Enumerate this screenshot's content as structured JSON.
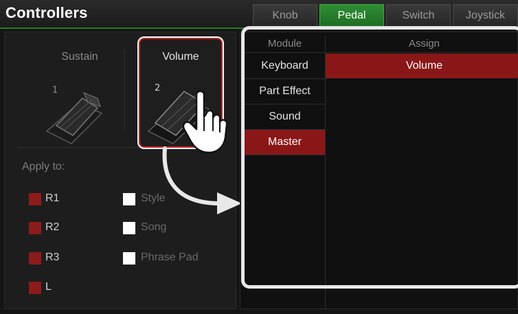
{
  "header": {
    "title": "Controllers",
    "tabs": [
      {
        "label": "Knob",
        "active": false
      },
      {
        "label": "Pedal",
        "active": true
      },
      {
        "label": "Switch",
        "active": false
      },
      {
        "label": "Joystick",
        "active": false
      }
    ]
  },
  "pedals": [
    {
      "label": "Sustain",
      "number": "1",
      "selected": false
    },
    {
      "label": "Volume",
      "number": "2",
      "selected": true
    }
  ],
  "apply_to": {
    "label": "Apply to:",
    "parts": [
      {
        "label": "R1",
        "checked": true
      },
      {
        "label": "R2",
        "checked": true
      },
      {
        "label": "R3",
        "checked": true
      },
      {
        "label": "L",
        "checked": true
      }
    ],
    "extras": [
      {
        "label": "Style",
        "enabled": false
      },
      {
        "label": "Song",
        "enabled": false
      },
      {
        "label": "Phrase Pad",
        "enabled": false
      }
    ]
  },
  "module_column": {
    "header": "Module",
    "items": [
      {
        "label": "Keyboard",
        "active": false
      },
      {
        "label": "Part Effect",
        "active": false
      },
      {
        "label": "Sound",
        "active": false
      },
      {
        "label": "Master",
        "active": true
      }
    ]
  },
  "assign_column": {
    "header": "Assign",
    "selected": "Volume"
  },
  "colors": {
    "accent_green": "#2f8e33",
    "selection_red": "#8a1717",
    "highlight_frame": "#e8e8e8"
  },
  "icons": [
    "sustain-pedal-icon",
    "volume-pedal-icon",
    "hand-pointer-icon",
    "curved-arrow-icon"
  ]
}
